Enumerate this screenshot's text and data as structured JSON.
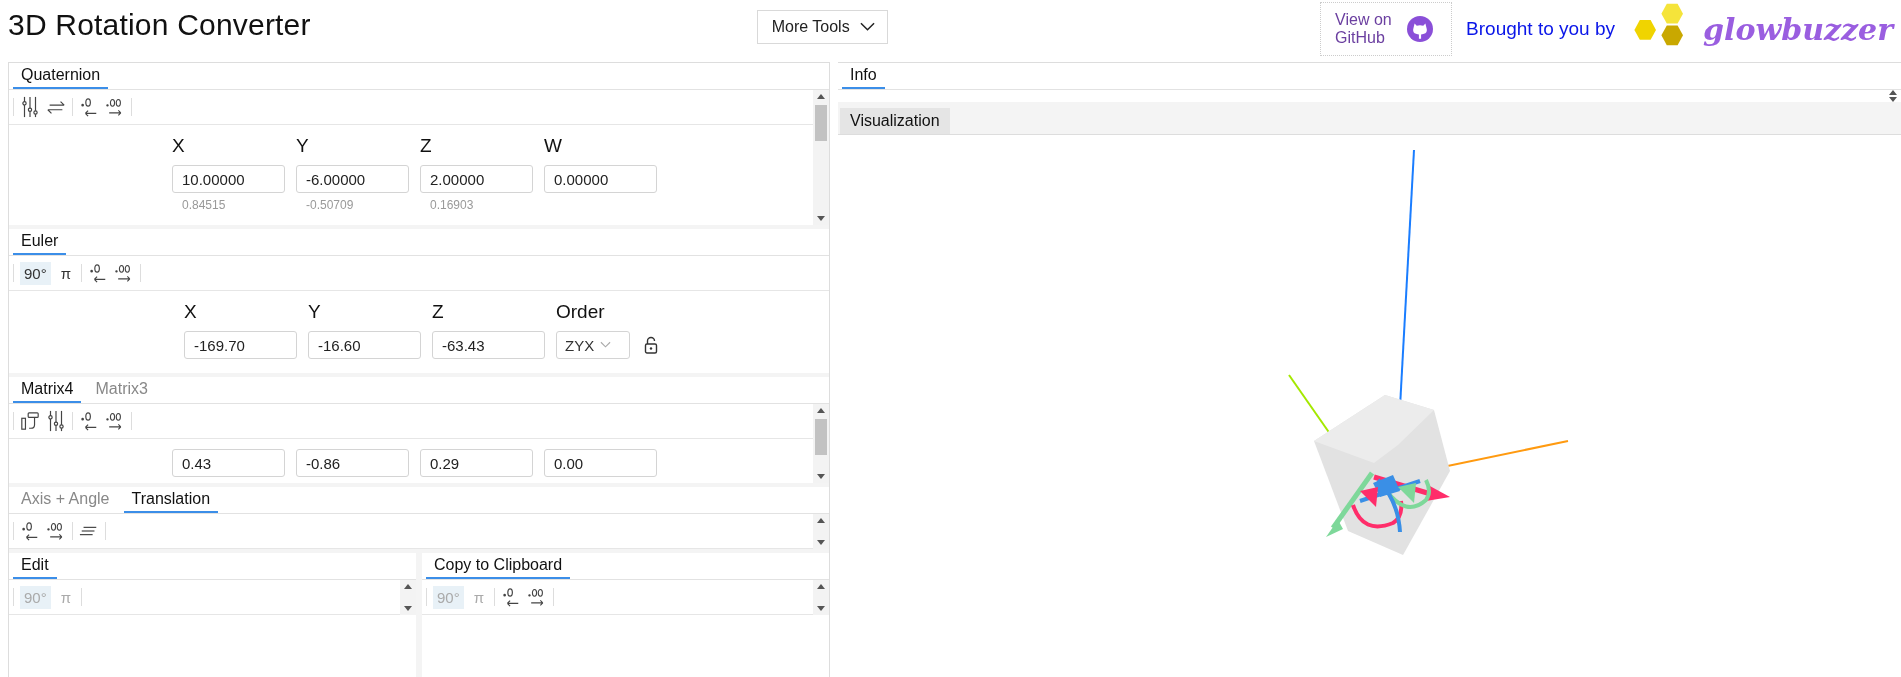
{
  "header": {
    "title": "3D Rotation Converter",
    "more_tools": "More Tools",
    "github": "View on GitHub",
    "credit": "Brought to you by",
    "logo": "glowbuzzer"
  },
  "quaternion": {
    "tabs": [
      {
        "label": "Quaternion",
        "selected": true
      }
    ],
    "toolbar": [
      {
        "kind": "sliders"
      },
      {
        "kind": "swap"
      },
      {
        "kind": "sep"
      },
      {
        "kind": "dec-less"
      },
      {
        "kind": "dec-more"
      }
    ],
    "fields": [
      {
        "label": "X",
        "value": "10.00000",
        "normalized": "0.84515"
      },
      {
        "label": "Y",
        "value": "-6.00000",
        "normalized": "-0.50709"
      },
      {
        "label": "Z",
        "value": "2.00000",
        "normalized": "0.16903"
      },
      {
        "label": "W",
        "value": "0.00000"
      }
    ]
  },
  "euler": {
    "tabs": [
      {
        "label": "Euler",
        "selected": true
      }
    ],
    "toolbar": [
      {
        "kind": "unit",
        "label": "90°",
        "selected": true
      },
      {
        "kind": "unit",
        "label": "π",
        "selected": false
      },
      {
        "kind": "sep"
      },
      {
        "kind": "dec-less"
      },
      {
        "kind": "dec-more"
      }
    ],
    "fields": [
      {
        "label": "X",
        "value": "-169.70"
      },
      {
        "label": "Y",
        "value": "-16.60"
      },
      {
        "label": "Z",
        "value": "-63.43"
      }
    ],
    "order": {
      "label": "Order",
      "value": "ZYX"
    }
  },
  "matrix": {
    "tabs": [
      {
        "label": "Matrix4",
        "selected": true
      },
      {
        "label": "Matrix3",
        "selected": false
      }
    ],
    "toolbar": [
      {
        "kind": "layout"
      },
      {
        "kind": "sliders"
      },
      {
        "kind": "sep"
      },
      {
        "kind": "dec-less"
      },
      {
        "kind": "dec-more"
      }
    ],
    "row": [
      "0.43",
      "-0.86",
      "0.29",
      "0.00"
    ]
  },
  "axis": {
    "tabs": [
      {
        "label": "Axis + Angle",
        "selected": false
      },
      {
        "label": "Translation",
        "selected": true
      }
    ],
    "toolbar": [
      {
        "kind": "dec-less"
      },
      {
        "kind": "dec-more"
      },
      {
        "kind": "sep"
      },
      {
        "kind": "align"
      }
    ]
  },
  "edit": {
    "tabs": [
      {
        "label": "Edit",
        "selected": true
      }
    ],
    "toolbar": [
      {
        "kind": "unit",
        "label": "90°",
        "selected": true,
        "disabled": true
      },
      {
        "kind": "unit",
        "label": "π",
        "selected": false,
        "disabled": true
      }
    ]
  },
  "copy": {
    "tabs": [
      {
        "label": "Copy to Clipboard",
        "selected": true
      }
    ],
    "toolbar": [
      {
        "kind": "unit",
        "label": "90°",
        "selected": true,
        "disabled": true
      },
      {
        "kind": "unit",
        "label": "π",
        "selected": false,
        "disabled": true
      },
      {
        "kind": "sep"
      },
      {
        "kind": "dec-less"
      },
      {
        "kind": "dec-more"
      }
    ]
  },
  "info": {
    "tabs": [
      {
        "label": "Info",
        "selected": true
      }
    ]
  },
  "visualization": {
    "tabs": [
      {
        "label": "Visualization",
        "selected": true
      }
    ]
  }
}
